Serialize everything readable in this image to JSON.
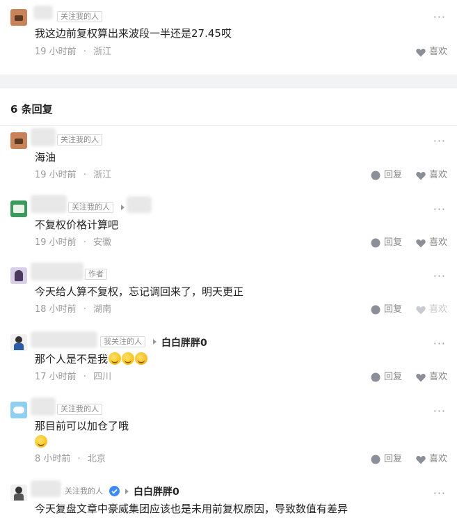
{
  "icons": {
    "more": "more-dots-icon",
    "reply": "comment-bubble-icon",
    "like": "heart-icon",
    "verified": "verified-check-icon"
  },
  "colors": {
    "meta_gray": "#999999",
    "tag_border": "#d8d8d8",
    "section_bg": "#f2f3f5",
    "verified_blue": "#3d8af7"
  },
  "top_comment": {
    "tag": "关注我的人",
    "text": "我这边前复权算出来波段一半还是27.45哎",
    "time": "19 小时前",
    "sep": "·",
    "location": "浙江",
    "like_label": "喜欢"
  },
  "replies_header": "6 条回复",
  "replies": [
    {
      "tag": "关注我的人",
      "text": "海油",
      "time": "19 小时前",
      "sep": "·",
      "location": "浙江",
      "reply_label": "回复",
      "like_label": "喜欢"
    },
    {
      "tag": "关注我的人",
      "text": "不复权价格计算吧",
      "time": "19 小时前",
      "sep": "·",
      "location": "安徽",
      "reply_label": "回复",
      "like_label": "喜欢"
    },
    {
      "tag": "作者",
      "text": "今天给人算不复权，忘记调回来了，明天更正",
      "time": "18 小时前",
      "sep": "·",
      "location": "湖南",
      "reply_label": "回复",
      "like_label": "喜欢"
    },
    {
      "tag": "我关注的人",
      "reply_to": "白白胖胖0",
      "text": "那个人是不是我",
      "time": "17 小时前",
      "sep": "·",
      "location": "四川",
      "reply_label": "回复",
      "like_label": "喜欢"
    },
    {
      "tag": "关注我的人",
      "text": "那目前可以加仓了哦",
      "time": "8 小时前",
      "sep": "·",
      "location": "北京",
      "reply_label": "回复",
      "like_label": "喜欢"
    },
    {
      "tag": "关注我的人",
      "reply_to": "白白胖胖0",
      "text": "今天复盘文章中豪威集团应该也是未用前复权原因，导致数值有差异"
    }
  ]
}
